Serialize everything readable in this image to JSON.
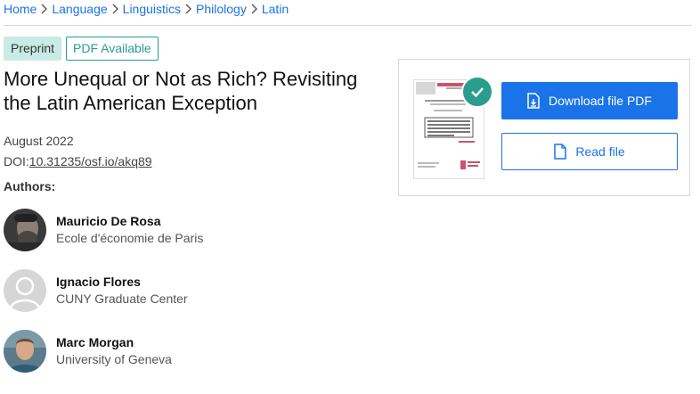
{
  "breadcrumb": [
    "Home",
    "Language",
    "Linguistics",
    "Philology",
    "Latin"
  ],
  "badges": {
    "preprint": "Preprint",
    "pdf": "PDF Available"
  },
  "publication": {
    "title": "More Unequal or Not as Rich? Revisiting the Latin American Exception",
    "date": "August 2022",
    "doi_label": "DOI:",
    "doi": "10.31235/osf.io/akq89"
  },
  "authors_label": "Authors:",
  "authors": [
    {
      "name": "Mauricio De Rosa",
      "affiliation": "Ecole d'économie de Paris"
    },
    {
      "name": "Ignacio Flores",
      "affiliation": "CUNY Graduate Center"
    },
    {
      "name": "Marc Morgan",
      "affiliation": "University of Geneva"
    }
  ],
  "file": {
    "download_label": "Download file PDF",
    "read_label": "Read file"
  },
  "colors": {
    "link": "#1a73e8",
    "accent": "#2a9d8f",
    "badge_bg": "#c8ebe6"
  },
  "icons": [
    "chevron-right-icon",
    "check-icon",
    "download-file-icon",
    "file-icon",
    "default-avatar-icon"
  ]
}
